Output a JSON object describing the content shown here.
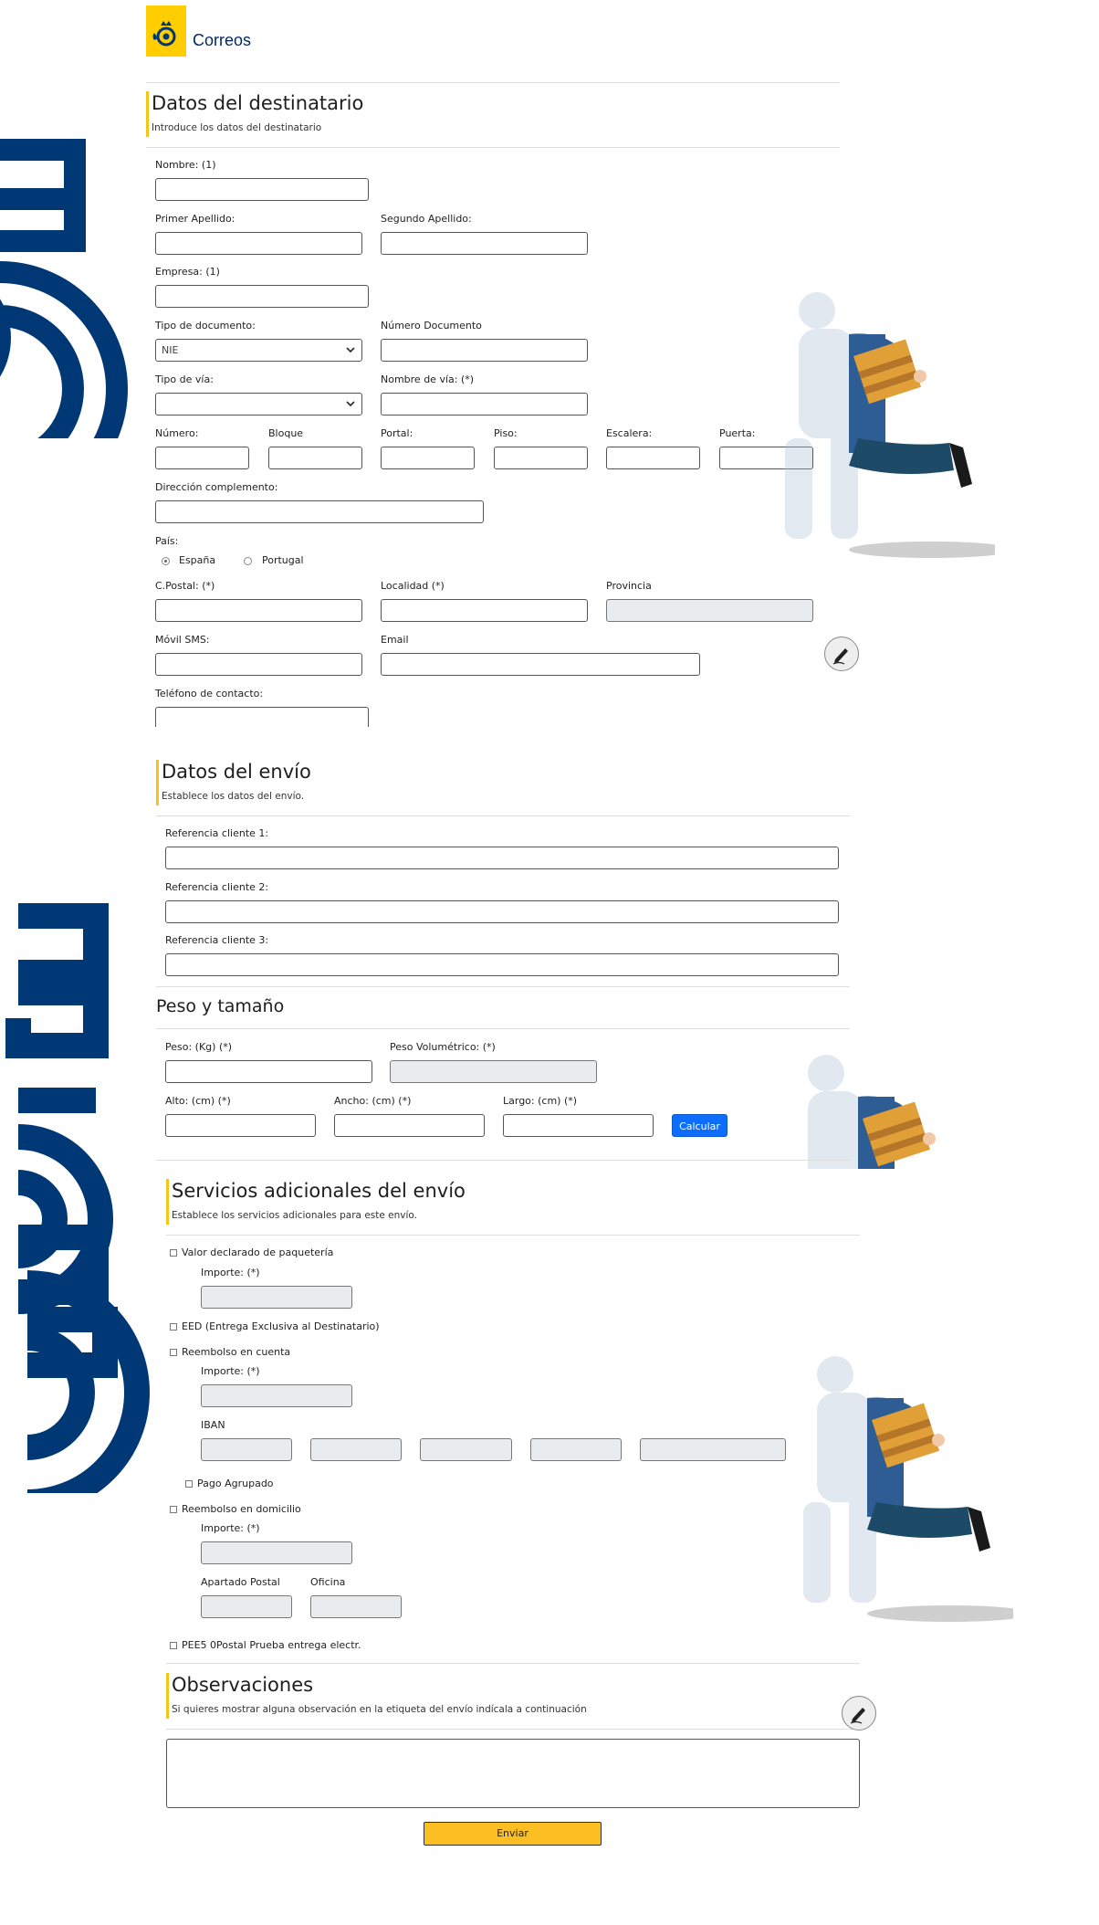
{
  "header": {
    "brand": "Correos",
    "logo_icon": "correos-horn-crown-logo",
    "brand_color": "#ffcd00"
  },
  "recipient": {
    "title": "Datos del destinatario",
    "subtitle": "Introduce los datos del destinatario",
    "nombre_label": "Nombre: (1)",
    "primer_apellido_label": "Primer Apellido:",
    "segundo_apellido_label": "Segundo Apellido:",
    "empresa_label": "Empresa: (1)",
    "tipo_documento_label": "Tipo de documento:",
    "tipo_documento_value": "NIE",
    "numero_documento_label": "Número Documento",
    "tipo_via_label": "Tipo de vía:",
    "tipo_via_value": "",
    "nombre_via_label": "Nombre de vía: (*)",
    "numero_label": "Número:",
    "bloque_label": "Bloque",
    "portal_label": "Portal:",
    "piso_label": "Piso:",
    "escalera_label": "Escalera:",
    "puerta_label": "Puerta:",
    "direccion_label": "Dirección complemento:",
    "pais_label": "País:",
    "pais_options": [
      "España",
      "Portugal"
    ],
    "pais_selected": "España",
    "cp_label": "C.Postal: (*)",
    "localidad_label": "Localidad (*)",
    "provincia_label": "Provincia",
    "movil_label": "Móvil SMS:",
    "email_label": "Email",
    "telefono_label": "Teléfono de contacto:"
  },
  "shipment": {
    "title": "Datos del envío",
    "subtitle": "Establece los datos del envío.",
    "ref1_label": "Referencia cliente 1:",
    "ref2_label": "Referencia cliente 2:",
    "ref3_label": "Referencia cliente 3:",
    "size_title": "Peso y tamaño",
    "peso_label": "Peso: (Kg) (*)",
    "peso_vol_label": "Peso Volumétrico: (*)",
    "alto_label": "Alto: (cm) (*)",
    "ancho_label": "Ancho: (cm) (*)",
    "largo_label": "Largo: (cm) (*)",
    "calcular_label": "Calcular"
  },
  "services": {
    "title": "Servicios adicionales del envío",
    "subtitle": "Establece los servicios adicionales para este envío.",
    "valor_declarado_label": "Valor declarado de paquetería",
    "importe_label": "Importe: (*)",
    "eed_label": "EED (Entrega Exclusiva al Destinatario)",
    "reembolso_cuenta_label": "Reembolso en cuenta",
    "iban_label": "IBAN",
    "pago_agrupado_label": "Pago Agrupado",
    "reembolso_domicilio_label": "Reembolso en domicilio",
    "apartado_label": "Apartado Postal",
    "oficina_label": "Oficina",
    "pee_label": "PEE5 0Postal Prueba entrega electr."
  },
  "observations": {
    "title": "Observaciones",
    "subtitle": "Si quieres mostrar alguna observación en la etiqueta del envío indícala a continuación",
    "value": ""
  },
  "submit_label": "Enviar",
  "colors": {
    "accent_yellow": "#f5c518",
    "brand_blue": "#003876",
    "button_blue": "#0d6efd",
    "submit_yellow": "#fbbf24"
  },
  "icons": [
    "correos-horn-crown-logo",
    "edit-pencil-icon",
    "chevron-down-icon",
    "mail-carrier-illustration",
    "correos-horn-watermark"
  ]
}
